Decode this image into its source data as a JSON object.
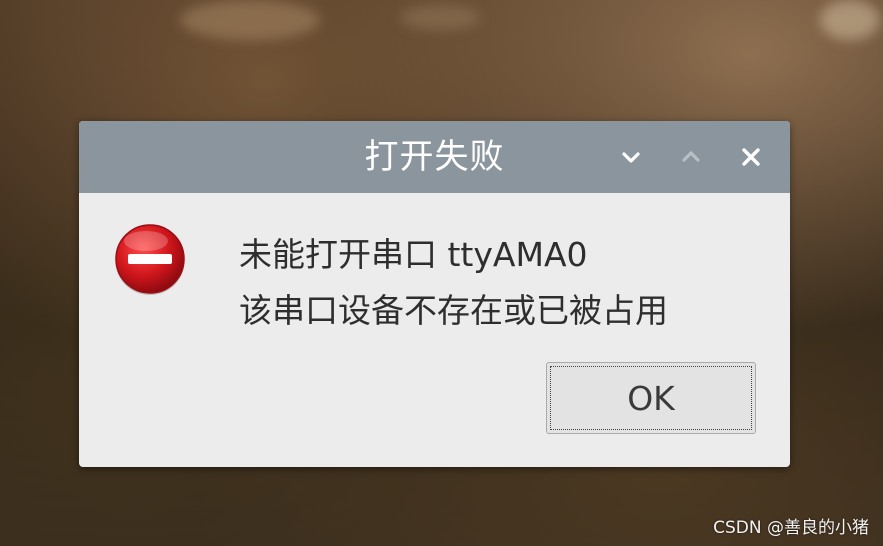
{
  "dialog": {
    "title": "打开失败",
    "controls": {
      "minimize_icon": "chevron-down-icon",
      "maximize_icon": "chevron-up-icon",
      "close_icon": "close-icon"
    },
    "icon": "error-icon",
    "message_line1": "未能打开串口 ttyAMA0",
    "message_line2": "该串口设备不存在或已被占用",
    "ok_label": "OK"
  },
  "watermark": "CSDN @善良的小猪",
  "colors": {
    "titlebar": "#8b959d",
    "dialog_bg": "#ececec",
    "error_red": "#d0161c",
    "text": "#2e2e2e"
  }
}
